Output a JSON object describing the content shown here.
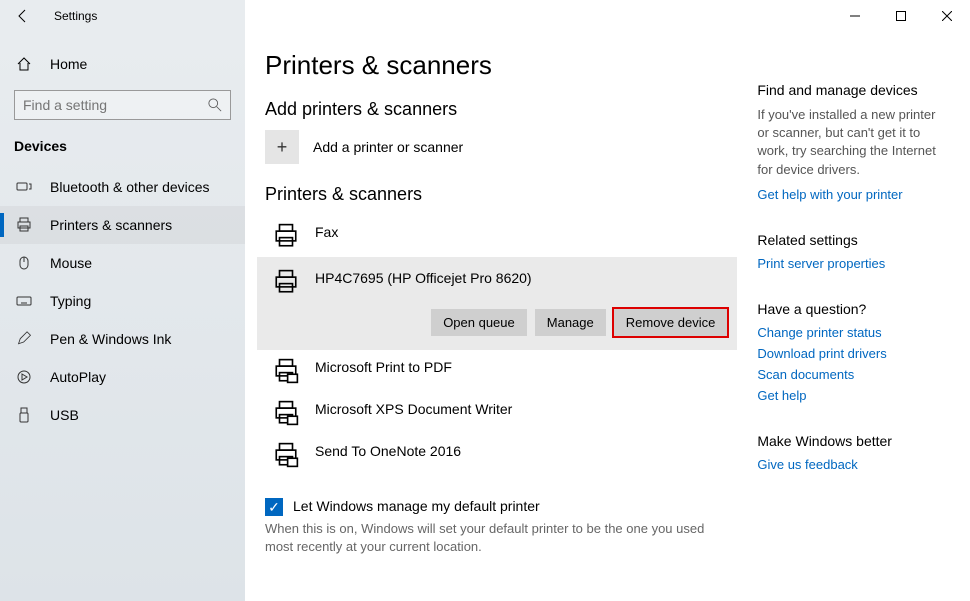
{
  "window": {
    "title": "Settings"
  },
  "sidebar": {
    "home": "Home",
    "search_placeholder": "Find a setting",
    "section": "Devices",
    "items": [
      {
        "label": "Bluetooth & other devices"
      },
      {
        "label": "Printers & scanners"
      },
      {
        "label": "Mouse"
      },
      {
        "label": "Typing"
      },
      {
        "label": "Pen & Windows Ink"
      },
      {
        "label": "AutoPlay"
      },
      {
        "label": "USB"
      }
    ]
  },
  "main": {
    "title": "Printers & scanners",
    "add_section": "Add printers & scanners",
    "add_label": "Add a printer or scanner",
    "list_section": "Printers & scanners",
    "printers": [
      {
        "name": "Fax"
      },
      {
        "name": "HP4C7695 (HP Officejet Pro 8620)"
      },
      {
        "name": "Microsoft Print to PDF"
      },
      {
        "name": "Microsoft XPS Document Writer"
      },
      {
        "name": "Send To OneNote 2016"
      }
    ],
    "actions": {
      "open_queue": "Open queue",
      "manage": "Manage",
      "remove": "Remove device"
    },
    "checkbox_label": "Let Windows manage my default printer",
    "checkbox_help": "When this is on, Windows will set your default printer to be the one you used most recently at your current location."
  },
  "right": {
    "find": {
      "header": "Find and manage devices",
      "body": "If you've installed a new printer or scanner, but can't get it to work, try searching the Internet for device drivers.",
      "link": "Get help with your printer"
    },
    "related": {
      "header": "Related settings",
      "link": "Print server properties"
    },
    "question": {
      "header": "Have a question?",
      "links": [
        "Change printer status",
        "Download print drivers",
        "Scan documents",
        "Get help"
      ]
    },
    "feedback": {
      "header": "Make Windows better",
      "link": "Give us feedback"
    }
  }
}
